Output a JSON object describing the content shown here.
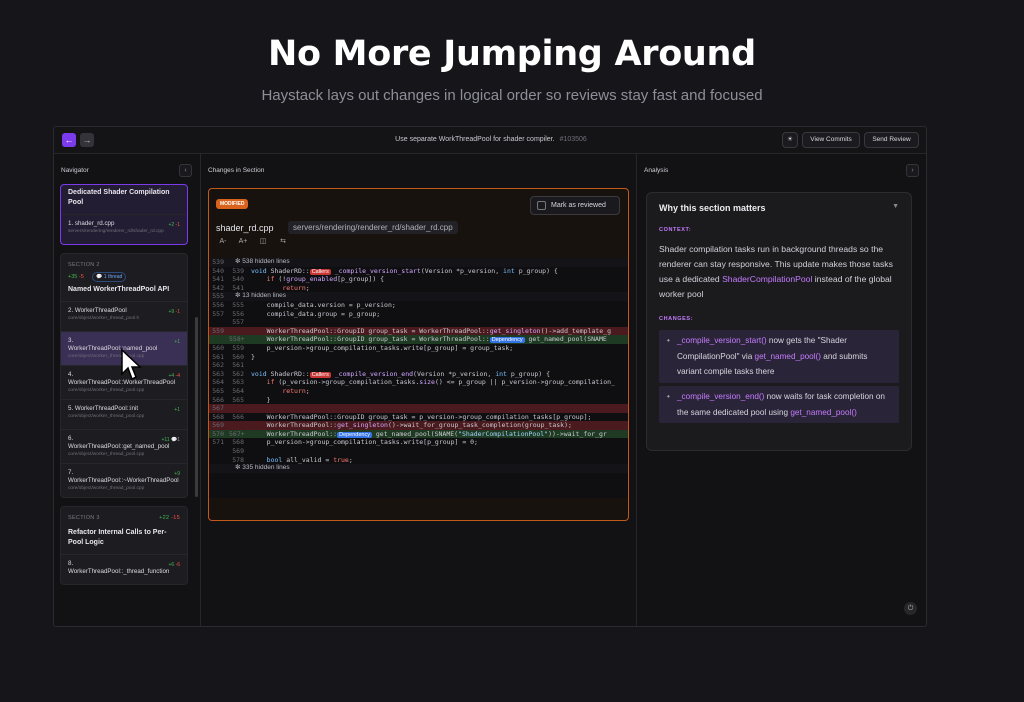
{
  "hero": {
    "title": "No More Jumping Around",
    "subtitle": "Haystack lays out changes in logical order so reviews stay fast and focused"
  },
  "topbar": {
    "back_icon": "arrow-left-icon",
    "forward_icon": "arrow-right-icon",
    "title": "Use separate WorkThreadPool for shader compiler.",
    "pr_number": "#103506",
    "view_commits": "View Commits",
    "send_review": "Send Review",
    "theme_icon": "sun-icon"
  },
  "navigator": {
    "title": "Navigator",
    "collapse": "‹",
    "section1": {
      "title": "Dedicated Shader Compilation Pool",
      "items": [
        {
          "name": "1. shader_rd.cpp",
          "path": "servers/rendering/renderer_rd/shader_rd.cpp",
          "add": "+2",
          "del": "-1"
        }
      ]
    },
    "section2": {
      "label": "SECTION 2",
      "add": "+35",
      "del": "-5",
      "threads": "1 thread",
      "title": "Named WorkerThreadPool API",
      "items": [
        {
          "name": "2. WorkerThreadPool",
          "path": "core/object/worker_thread_pool.h",
          "add": "+9",
          "del": "-1"
        },
        {
          "name": "3. WorkerThreadPool::named_pool",
          "path": "core/object/worker_thread_pool.cpp",
          "add": "+1",
          "del": ""
        },
        {
          "name": "4. WorkerThreadPool::WorkerThreadPool",
          "path": "core/object/worker_thread_pool.cpp",
          "add": "+4",
          "del": "-4"
        },
        {
          "name": "5. WorkerThreadPool::init",
          "path": "core/object/worker_thread_pool.cpp",
          "add": "+1",
          "del": ""
        },
        {
          "name": "6. WorkerThreadPool::get_named_pool",
          "path": "core/object/worker_thread_pool.cpp",
          "add": "+11",
          "del": "",
          "comments": "1"
        },
        {
          "name": "7. WorkerThreadPool::~WorkerThreadPool",
          "path": "core/object/worker_thread_pool.cpp",
          "add": "+9",
          "del": ""
        }
      ]
    },
    "section3": {
      "label": "SECTION 3",
      "add": "+22",
      "del": "-15",
      "title": "Refactor Internal Calls to Per-Pool Logic",
      "items": [
        {
          "name": "8. WorkerThreadPool::_thread_function",
          "path": "",
          "add": "+6",
          "del": "-6"
        }
      ]
    }
  },
  "changes": {
    "title": "Changes in Section",
    "badge": "MODIFIED",
    "mark_reviewed": "Mark as reviewed",
    "file_name": "shader_rd.cpp",
    "file_path": "servers/rendering/renderer_rd/shader_rd.cpp",
    "tools": [
      "A-",
      "A+"
    ],
    "hidden_top": "538 hidden lines",
    "hidden_mid": "13 hidden lines",
    "hidden_bottom": "335 hidden lines",
    "callers_label": "Callers",
    "dependency_label": "Dependency"
  },
  "analysis": {
    "title": "Analysis",
    "collapse": "›",
    "card_title": "Why this section matters",
    "context_label": "CONTEXT:",
    "context_pre": "Shader compilation tasks run in background threads so the renderer can stay responsive. This update makes those tasks use a dedicated ",
    "context_accent": "ShaderCompilationPool",
    "context_post": " instead of the global worker pool",
    "changes_label": "CHANGES:",
    "change1_fn": "_compile_version_start()",
    "change1_mid": " now gets the \"Shader CompilationPool\" via ",
    "change1_fn2": "get_named_pool()",
    "change1_post": " and submits variant compile tasks there",
    "change2_fn": "_compile_version_end()",
    "change2_mid": " now waits for task completion on the same dedicated pool using ",
    "change2_fn2": "get_named_pool()"
  },
  "colors": {
    "accent": "#7c3aed",
    "modified": "#d9621c",
    "add": "#3fb950",
    "del": "#f85149"
  }
}
